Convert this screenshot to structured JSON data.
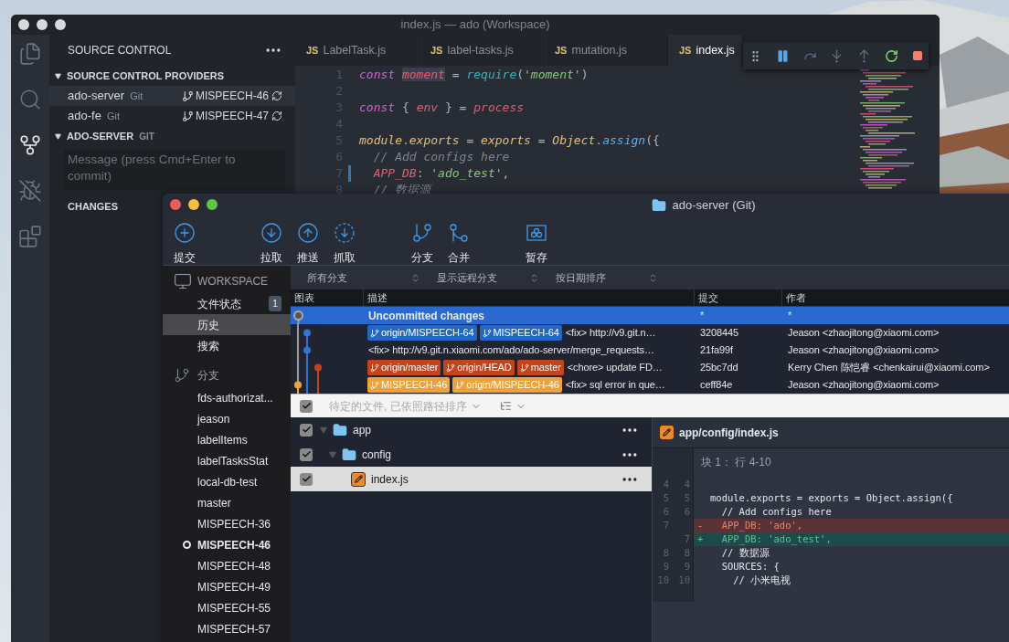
{
  "vscode": {
    "title": "index.js — ado (Workspace)",
    "activity_bar": [
      {
        "kind": "files",
        "selected": false
      },
      {
        "kind": "search",
        "selected": false
      },
      {
        "kind": "scm",
        "selected": true
      },
      {
        "kind": "debug",
        "selected": false
      },
      {
        "kind": "extensions",
        "selected": false
      }
    ],
    "sidebar": {
      "title": "SOURCE CONTROL",
      "providers_header": "SOURCE CONTROL PROVIDERS",
      "providers": [
        {
          "name": "ado-server",
          "type": "Git",
          "branch": "MISPEECH-46",
          "selected": true
        },
        {
          "name": "ado-fe",
          "type": "Git",
          "branch": "MISPEECH-47",
          "selected": false
        }
      ],
      "repo_header": "ADO-SERVER",
      "repo_type": "GIT",
      "message_placeholder": "Message (press Cmd+Enter to commit)",
      "changes_header": "CHANGES"
    },
    "tabs": [
      {
        "badge": "JS",
        "label": "LabelTask.js",
        "selected": false
      },
      {
        "badge": "JS",
        "label": "label-tasks.js",
        "selected": false
      },
      {
        "badge": "JS",
        "label": "mutation.js",
        "selected": false
      },
      {
        "badge": "JS",
        "label": "index.js",
        "selected": true
      }
    ],
    "debug_toolbar": [
      {
        "kind": "grip"
      },
      {
        "kind": "pause"
      },
      {
        "kind": "step-over"
      },
      {
        "kind": "step-into"
      },
      {
        "kind": "step-out"
      },
      {
        "kind": "restart"
      },
      {
        "kind": "stop"
      }
    ],
    "editor": {
      "lines": [
        {
          "number": "1",
          "modified": false,
          "tokens": [
            {
              "kind": "keyword",
              "text": "const "
            },
            {
              "kind": "variable",
              "text": "moment",
              "highlighted": true
            },
            {
              "kind": "plain",
              "text": " = "
            },
            {
              "kind": "function",
              "text": "require"
            },
            {
              "kind": "plain",
              "text": "("
            },
            {
              "kind": "string",
              "text": "'moment'"
            },
            {
              "kind": "plain",
              "text": ")"
            }
          ]
        },
        {
          "number": "2",
          "modified": false
        },
        {
          "number": "3",
          "modified": false,
          "tokens": [
            {
              "kind": "keyword",
              "text": "const "
            },
            {
              "kind": "plain",
              "text": "{ "
            },
            {
              "kind": "variable",
              "text": "env"
            },
            {
              "kind": "plain",
              "text": " } = "
            },
            {
              "kind": "variable",
              "text": "process"
            }
          ]
        },
        {
          "number": "4",
          "modified": false
        },
        {
          "number": "5",
          "modified": false,
          "tokens": [
            {
              "kind": "class",
              "text": "module"
            },
            {
              "kind": "plain",
              "text": "."
            },
            {
              "kind": "class",
              "text": "exports"
            },
            {
              "kind": "plain",
              "text": " = "
            },
            {
              "kind": "class",
              "text": "exports"
            },
            {
              "kind": "plain",
              "text": " = "
            },
            {
              "kind": "class",
              "text": "Object"
            },
            {
              "kind": "plain",
              "text": "."
            },
            {
              "kind": "method",
              "text": "assign"
            },
            {
              "kind": "plain",
              "text": "({"
            }
          ]
        },
        {
          "number": "6",
          "modified": false,
          "tokens": [
            {
              "kind": "comment",
              "text": "  // Add configs here"
            }
          ]
        },
        {
          "number": "7",
          "modified": true,
          "tokens": [
            {
              "kind": "variable",
              "text": "  APP_DB"
            },
            {
              "kind": "plain",
              "text": ": "
            },
            {
              "kind": "string",
              "text": "'ado_test'"
            },
            {
              "kind": "plain",
              "text": ","
            }
          ]
        },
        {
          "number": "8",
          "modified": false,
          "tokens": [
            {
              "kind": "comment",
              "text": "  // 数据源"
            }
          ]
        }
      ]
    }
  },
  "sourcetree": {
    "title": "ado-server (Git)",
    "toolbar": [
      {
        "kind": "commit",
        "label": "提交"
      },
      {
        "kind": "pull",
        "label": "拉取"
      },
      {
        "kind": "push",
        "label": "推送"
      },
      {
        "kind": "fetch",
        "label": "抓取"
      },
      {
        "kind": "branch",
        "label": "分支"
      },
      {
        "kind": "merge",
        "label": "合并"
      },
      {
        "kind": "stash",
        "label": "暂存"
      }
    ],
    "sidebar": {
      "workspace_header": "WORKSPACE",
      "workspace_items": [
        {
          "label": "文件状态",
          "badge": "1",
          "selected": false
        },
        {
          "label": "历史",
          "selected": true
        },
        {
          "label": "搜索",
          "selected": false
        }
      ],
      "branches_header": "分支",
      "branches": [
        {
          "name": "fds-authorizat...",
          "current": false
        },
        {
          "name": "jeason",
          "current": false
        },
        {
          "name": "labelItems",
          "current": false
        },
        {
          "name": "labelTasksStat",
          "current": false
        },
        {
          "name": "local-db-test",
          "current": false
        },
        {
          "name": "master",
          "current": false
        },
        {
          "name": "MISPEECH-36",
          "current": false
        },
        {
          "name": "MISPEECH-46",
          "current": true
        },
        {
          "name": "MISPEECH-48",
          "current": false
        },
        {
          "name": "MISPEECH-49",
          "current": false
        },
        {
          "name": "MISPEECH-55",
          "current": false
        },
        {
          "name": "MISPEECH-57",
          "current": false
        }
      ]
    },
    "filters": [
      "所有分支",
      "显示远程分支",
      "按日期排序"
    ],
    "columns": [
      "图表",
      "描述",
      "提交",
      "作者"
    ],
    "commits": [
      {
        "kind": "uncommitted",
        "selected": true,
        "description": "Uncommitted changes",
        "commit": "*",
        "author": "*"
      },
      {
        "kind": "commit",
        "selected": false,
        "tags": [
          {
            "name": "origin/MISPEECH-64",
            "color": "#2366c4"
          },
          {
            "name": "MISPEECH-64",
            "color": "#2366c4"
          }
        ],
        "description": "<fix> http://v9.git.n…",
        "commit": "3208445",
        "author": "Jeason <zhaojitong@xiaomi.com>"
      },
      {
        "kind": "commit",
        "selected": false,
        "description": "<fix> http://v9.git.n.xiaomi.com/ado/ado-server/merge_requests…",
        "commit": "21fa99f",
        "author": "Jeason <zhaojitong@xiaomi.com>"
      },
      {
        "kind": "commit",
        "selected": false,
        "tags": [
          {
            "name": "origin/master",
            "color": "#c4441c"
          },
          {
            "name": "origin/HEAD",
            "color": "#c4441c"
          },
          {
            "name": "master",
            "color": "#c4441c"
          }
        ],
        "description": "<chore> update FD…",
        "commit": "25bc7dd",
        "author": "Kerry Chen 陈恺睿 <chenkairui@xiaomi.com>"
      },
      {
        "kind": "commit",
        "selected": false,
        "tags": [
          {
            "name": "MISPEECH-46",
            "color": "#f0a23a"
          },
          {
            "name": "origin/MISPEECH-46",
            "color": "#f0a23a"
          }
        ],
        "description": "<fix> sql error in que…",
        "commit": "ceff84e",
        "author": "Jeason <zhaojitong@xiaomi.com>"
      }
    ],
    "pending_bar": {
      "checked": true,
      "label": "待定的文件, 已依照路径排序"
    },
    "files": [
      {
        "kind": "folder",
        "name": "app",
        "checked": true,
        "expanded": true,
        "selected": false,
        "children": [
          {
            "kind": "folder",
            "name": "config",
            "checked": true,
            "expanded": true,
            "selected": false,
            "children": [
              {
                "kind": "file",
                "name": "index.js",
                "checked": true,
                "selected": true
              }
            ]
          }
        ]
      }
    ],
    "diff": {
      "path": "app/config/index.js",
      "hunk": "块 1： 行 4-10",
      "lines": [
        {
          "kind": "context",
          "old": "4",
          "new": "4"
        },
        {
          "kind": "context",
          "old": "5",
          "new": "5",
          "text": "module.exports = exports = Object.assign({"
        },
        {
          "kind": "context",
          "old": "6",
          "new": "6",
          "text": "  // Add configs here"
        },
        {
          "kind": "removed",
          "old": "7",
          "sign": "-",
          "text": "  APP_DB: 'ado',"
        },
        {
          "kind": "added",
          "new": "7",
          "sign": "+",
          "text": "  APP_DB: 'ado_test',"
        },
        {
          "kind": "context",
          "old": "8",
          "new": "8",
          "text": "  // 数据源"
        },
        {
          "kind": "context",
          "old": "9",
          "new": "9",
          "text": "  SOURCES: {"
        },
        {
          "kind": "context",
          "old": "10",
          "new": "10",
          "text": "    // 小米电视"
        }
      ]
    }
  }
}
